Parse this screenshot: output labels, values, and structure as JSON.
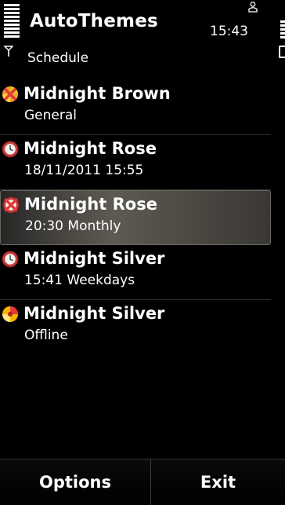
{
  "header": {
    "app_title": "AutoThemes",
    "clock": "15:43",
    "subtitle": "Schedule"
  },
  "status_icons": {
    "signal": "signal-bars-icon",
    "battery": "battery-bars-icon",
    "profile": "person-icon",
    "antenna": "antenna-icon"
  },
  "schedule": {
    "items": [
      {
        "name": "Midnight Brown",
        "detail": "General",
        "icon": "profile-icon",
        "selected": false
      },
      {
        "name": "Midnight Rose",
        "detail": "18/11/2011 15:55",
        "icon": "clock-icon",
        "selected": false
      },
      {
        "name": "Midnight Rose",
        "detail": "20:30 Monthly",
        "icon": "disabled-clock-icon",
        "selected": true
      },
      {
        "name": "Midnight Silver",
        "detail": "15:41 Weekdays",
        "icon": "clock-icon",
        "selected": false
      },
      {
        "name": "Midnight Silver",
        "detail": "Offline",
        "icon": "offline-profile-icon",
        "selected": false
      }
    ]
  },
  "softkeys": {
    "left_label": "Options",
    "right_label": "Exit"
  },
  "colors": {
    "background": "#000000",
    "text": "#ffffff",
    "selection": "#5d5a53",
    "clock_icon": "#c0392b",
    "disabled_icon": "#e53935",
    "offline_icon_yellow": "#f4b400"
  }
}
